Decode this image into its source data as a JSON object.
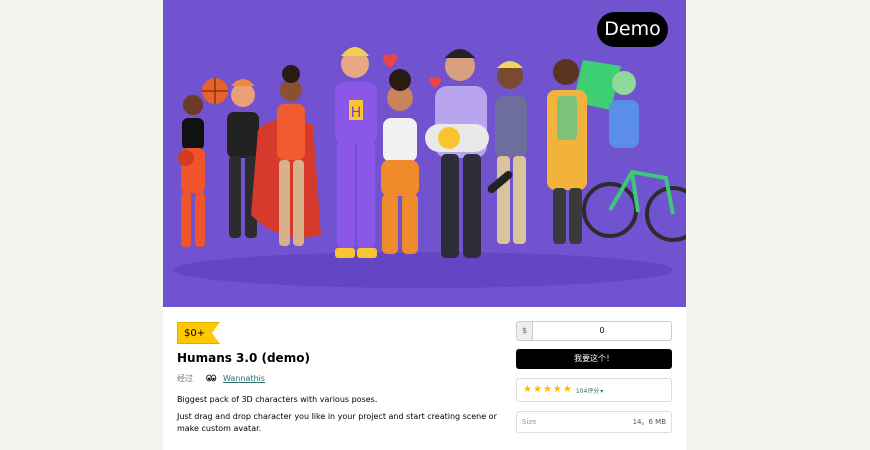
{
  "cover": {
    "demo_badge": "Demo",
    "background": "#7152cf"
  },
  "product": {
    "price_tag": "$0+",
    "title": "Humans 3.0 (demo)",
    "by_label": "经过",
    "author": "Wannathis",
    "description": [
      "Biggest pack of 3D characters with various poses.",
      "Just drag and drop character you like in your project and start creating scene or make custom avatar."
    ]
  },
  "purchase": {
    "currency_symbol": "$",
    "price_value": "0",
    "buy_label": "我要这个！",
    "rating_count_label": "104评分",
    "stars": 5,
    "size_label": "Size",
    "size_value": "14。6 MB"
  },
  "colors": {
    "accent": "#ffc900",
    "star": "#ffb800",
    "link": "#2b6b6b"
  }
}
